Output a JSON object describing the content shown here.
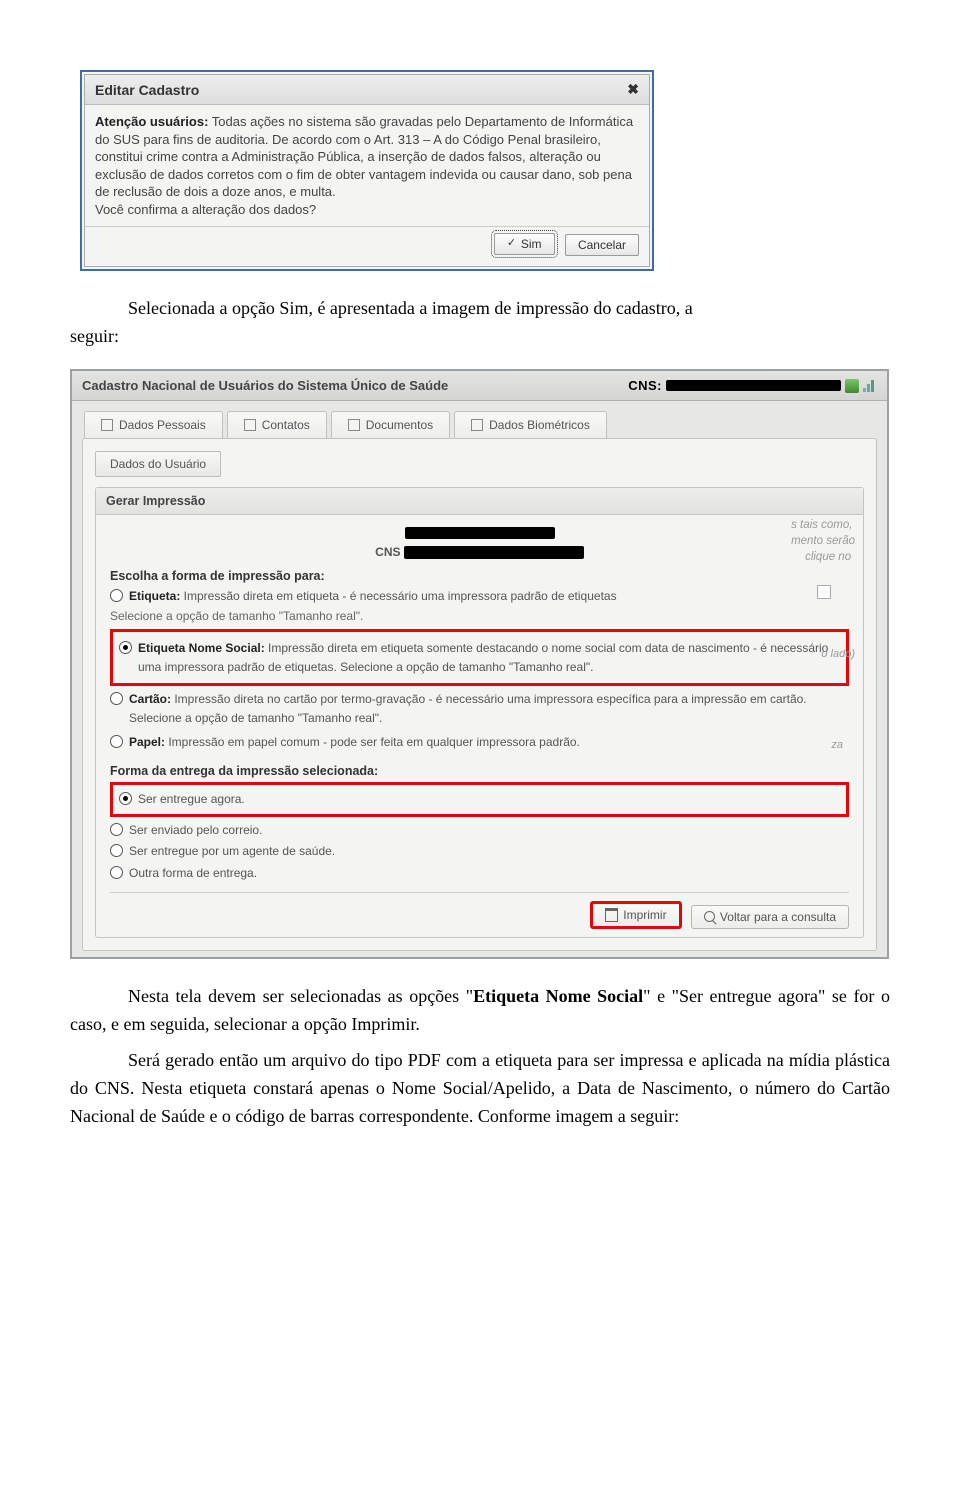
{
  "dialog1": {
    "title": "Editar Cadastro",
    "body_strong": "Atenção usuários:",
    "body_text": " Todas ações no sistema são gravadas pelo Departamento de Informática do SUS para fins de auditoria. De acordo com o Art. 313 – A do Código Penal brasileiro, constitui crime contra a Administração Pública, a inserção de dados falsos, alteração ou exclusão de dados corretos com o fim de obter vantagem indevida ou causar dano, sob pena de reclusão de dois a doze anos, e multa.",
    "body_confirm": "Você confirma a alteração dos dados?",
    "btn_yes": "Sim",
    "btn_cancel": "Cancelar"
  },
  "para1_pre": "seguir:",
  "para1": "Selecionada a opção Sim, é apresentada a imagem de impressão do cadastro, a",
  "panel": {
    "title": "Cadastro Nacional de Usuários do Sistema Único de Saúde",
    "cns_label": "CNS:",
    "tabs": [
      "Dados Pessoais",
      "Contatos",
      "Documentos",
      "Dados Biométricos"
    ],
    "sub_btn": "Dados do Usuário",
    "print_title": "Gerar Impressão",
    "bg_hint1": "s tais como,",
    "bg_hint2": "mento serão",
    "bg_hint3": "clique no",
    "cns_center": "CNS",
    "heading_forma": "Escolha a forma de impressão para:",
    "opt_etiqueta_b": "Etiqueta:",
    "opt_etiqueta_t": " Impressão direta em etiqueta - é necessário uma impressora padrão de etiquetas",
    "opt_etiqueta_note": "Selecione a opção de tamanho \"Tamanho real\".",
    "opt_nomesocial_b": "Etiqueta Nome Social:",
    "opt_nomesocial_t": " Impressão direta em etiqueta somente destacando o nome social com data de nascimento - é necessário uma impressora padrão de etiquetas. Selecione a opção de tamanho \"Tamanho real\".",
    "side_lado": "o lado)",
    "opt_cartao_b": "Cartão:",
    "opt_cartao_t": " Impressão direta no cartão por termo-gravação - é necessário uma impressora específica para a impressão em cartão. Selecione a opção de tamanho \"Tamanho real\".",
    "opt_papel_b": "Papel:",
    "opt_papel_t": " Impressão em papel comum - pode ser feita em qualquer impressora padrão.",
    "side_za": "za",
    "heading_entrega": "Forma da entrega da impressão selecionada:",
    "ent1": "Ser entregue agora.",
    "ent2": "Ser enviado pelo correio.",
    "ent3": "Ser entregue por um agente de saúde.",
    "ent4": "Outra forma de entrega.",
    "btn_print": "Imprimir",
    "btn_back": "Voltar para a consulta"
  },
  "para2_a": "Nesta tela devem ser selecionadas as opções \"",
  "para2_b1": "Etiqueta Nome Social",
  "para2_b": "\" e \"Ser entregue agora\" se for o caso, e em seguida, selecionar a opção Imprimir.",
  "para3": "Será gerado então um arquivo do tipo PDF com a etiqueta para ser impressa e aplicada na mídia plástica do CNS. Nesta etiqueta constará apenas o Nome Social/Apelido, a Data de Nascimento, o número do Cartão Nacional de Saúde e o código de barras correspondente. Conforme imagem a seguir:"
}
